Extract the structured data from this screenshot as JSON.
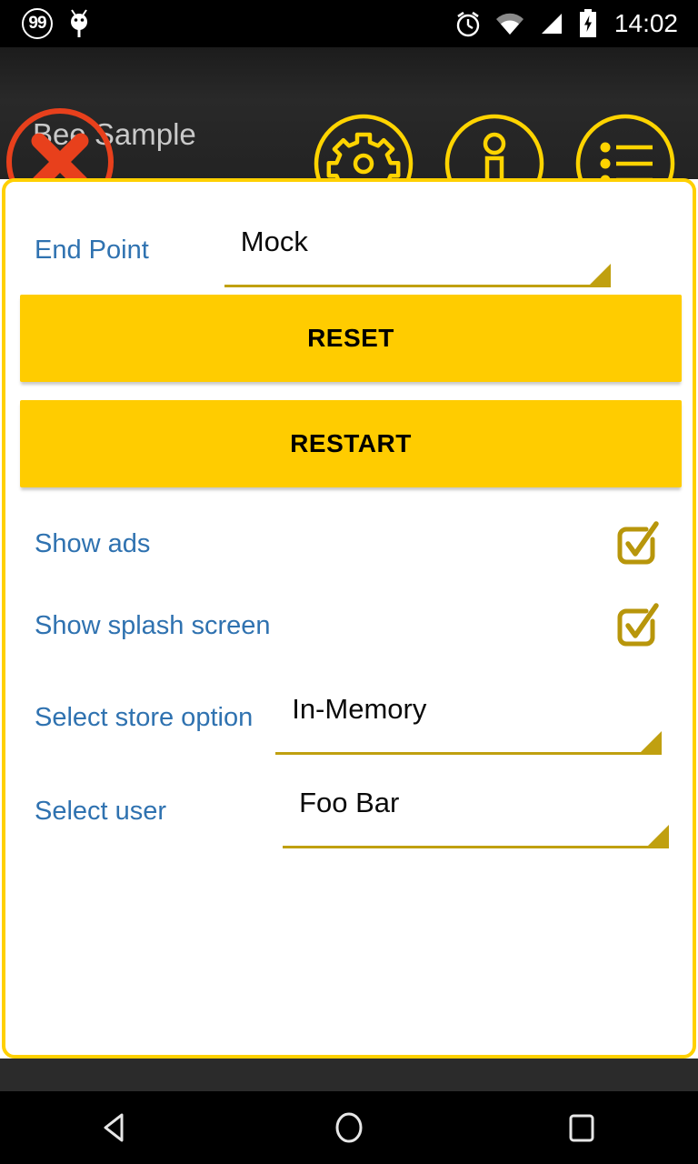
{
  "statusbar": {
    "badge_count": "99",
    "time": "14:02",
    "icons": [
      "badge-99-icon",
      "android-bug-icon",
      "alarm-clock-icon",
      "wifi-icon",
      "cellular-signal-icon",
      "battery-charging-icon"
    ]
  },
  "appbar": {
    "title": "Bee Sample",
    "close_label": "close-overlay",
    "actions": [
      {
        "name": "settings",
        "icon": "gear-icon"
      },
      {
        "name": "info",
        "icon": "info-icon"
      },
      {
        "name": "menu",
        "icon": "list-icon"
      }
    ]
  },
  "settings": {
    "endpoint": {
      "label": "End Point",
      "value": "Mock"
    },
    "reset_button": "RESET",
    "restart_button": "RESTART",
    "show_ads": {
      "label": "Show ads",
      "checked": "true"
    },
    "show_splash": {
      "label": "Show splash screen",
      "checked": "true"
    },
    "store_option": {
      "label": "Select store option",
      "value": "In-Memory"
    },
    "user": {
      "label": "Select user",
      "value": "Foo Bar"
    }
  },
  "navbar": {
    "back": "back-button",
    "home": "home-button",
    "recents": "recents-button"
  },
  "colors": {
    "accent_yellow": "#FFD000",
    "button_yellow": "#FFCC00",
    "label_blue": "#2F72B0",
    "gold": "#C0A010",
    "close_red": "#E8401C",
    "appbar_dark": "#232323"
  }
}
